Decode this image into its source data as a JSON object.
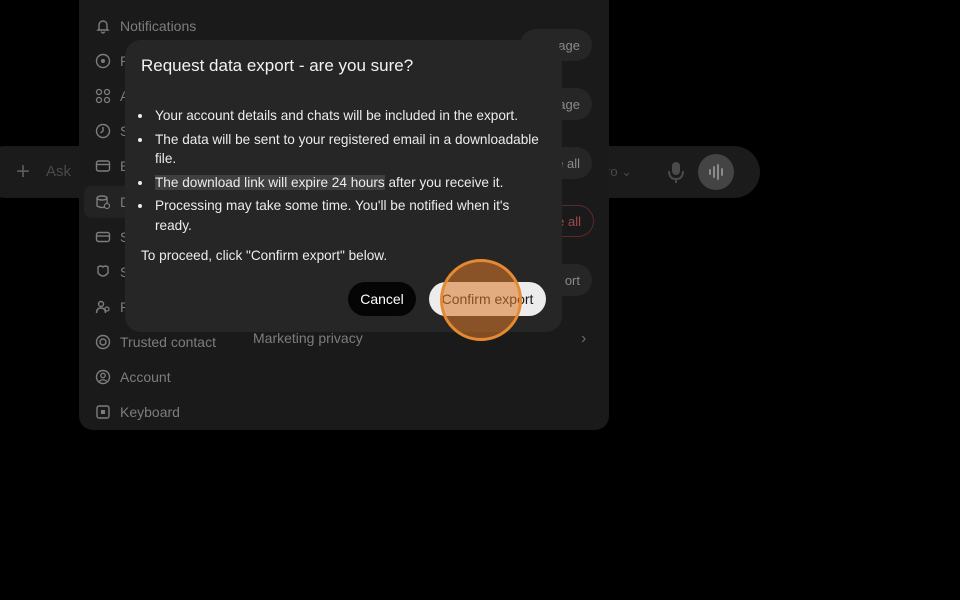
{
  "chat": {
    "placeholder": "Ask",
    "model_label": "ro"
  },
  "settings": {
    "nav": [
      {
        "label": "Notifications",
        "icon": "bell-icon"
      },
      {
        "label": "P",
        "icon": "palette-icon"
      },
      {
        "label": "A",
        "icon": "apps-icon"
      },
      {
        "label": "S",
        "icon": "clock-icon"
      },
      {
        "label": "B",
        "icon": "billing-icon"
      },
      {
        "label": "D",
        "icon": "database-icon"
      },
      {
        "label": "S",
        "icon": "card-icon"
      },
      {
        "label": "S",
        "icon": "shield-icon"
      },
      {
        "label": "P",
        "icon": "people-icon"
      },
      {
        "label": "Trusted contact",
        "icon": "lifebuoy-icon"
      },
      {
        "label": "Account",
        "icon": "user-circle-icon"
      },
      {
        "label": "Keyboard",
        "icon": "keyboard-icon"
      }
    ],
    "right_buttons": [
      "age",
      "age",
      "e all",
      "e all",
      "ort"
    ],
    "marketing_label": "Marketing privacy"
  },
  "modal": {
    "title": "Request data export - are you sure?",
    "bullets": [
      "Your account details and chats will be included in the export.",
      "The data will be sent to your registered email in a downloadable file.",
      "after you receive it.",
      "Processing may take some time. You'll be notified when it's ready."
    ],
    "highlight_text": "The download link will expire 24 hours",
    "proceed_text": "To proceed, click \"Confirm export\" below.",
    "cancel_label": "Cancel",
    "confirm_label": "Confirm export"
  },
  "colors": {
    "click_indicator": "#e58a32",
    "modal_bg": "#262626",
    "confirm_bg": "#ececec"
  }
}
